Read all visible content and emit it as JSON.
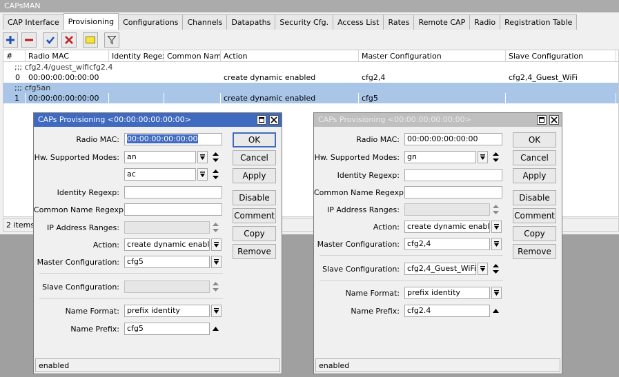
{
  "window": {
    "title": "CAPsMAN"
  },
  "tabs": [
    "CAP Interface",
    "Provisioning",
    "Configurations",
    "Channels",
    "Datapaths",
    "Security Cfg.",
    "Access List",
    "Rates",
    "Remote CAP",
    "Radio",
    "Registration Table"
  ],
  "active_tab": "Provisioning",
  "table": {
    "columns": [
      "#",
      "Radio MAC",
      "Identity Regexp",
      "Common Nam...",
      "Action",
      "Master Configuration",
      "Slave Configuration"
    ],
    "rows": [
      {
        "comment": ";;; cfg2.4/guest_wificfg2.4",
        "num": "0",
        "radio_mac": "00:00:00:00:00:00",
        "identity": "",
        "common": "",
        "action": "create dynamic enabled",
        "master": "cfg2,4",
        "slave": "cfg2,4_Guest_WiFi"
      },
      {
        "comment": ";;; cfg5an",
        "num": "1",
        "radio_mac": "00:00:00:00:00:00",
        "identity": "",
        "common": "",
        "action": "create dynamic enabled",
        "master": "cfg5",
        "slave": ""
      }
    ],
    "status": "2 items ("
  },
  "dialog1": {
    "title": "CAPs Provisioning <00:00:00:00:00:00>",
    "labels": {
      "radio_mac": "Radio MAC:",
      "hw_modes": "Hw. Supported Modes:",
      "identity": "Identity Regexp:",
      "common_name": "Common Name Regexp:",
      "ip_ranges": "IP Address Ranges:",
      "action": "Action:",
      "master": "Master Configuration:",
      "slave": "Slave Configuration:",
      "name_format": "Name Format:",
      "name_prefix": "Name Prefix:"
    },
    "values": {
      "radio_mac": "00:00:00:00:00:00",
      "hw_mode_1": "an",
      "hw_mode_2": "ac",
      "identity": "",
      "common_name": "",
      "ip_ranges": "",
      "action": "create dynamic enabled",
      "master": "cfg5",
      "slave": "",
      "name_format": "prefix identity",
      "name_prefix": "cfg5"
    },
    "buttons": {
      "ok": "OK",
      "cancel": "Cancel",
      "apply": "Apply",
      "disable": "Disable",
      "comment": "Comment",
      "copy": "Copy",
      "remove": "Remove"
    },
    "status": "enabled"
  },
  "dialog2": {
    "title": "CAPs Provisioning <00:00:00:00:00:00>",
    "labels": {
      "radio_mac": "Radio MAC:",
      "hw_modes": "Hw. Supported Modes:",
      "identity": "Identity Regexp:",
      "common_name": "Common Name Regexp:",
      "ip_ranges": "IP Address Ranges:",
      "action": "Action:",
      "master": "Master Configuration:",
      "slave": "Slave Configuration:",
      "name_format": "Name Format:",
      "name_prefix": "Name Prefix:"
    },
    "values": {
      "radio_mac": "00:00:00:00:00:00",
      "hw_mode_1": "gn",
      "identity": "",
      "common_name": "",
      "ip_ranges": "",
      "action": "create dynamic enabled",
      "master": "cfg2,4",
      "slave": "cfg2,4_Guest_WiFi",
      "name_format": "prefix identity",
      "name_prefix": "cfg2.4"
    },
    "buttons": {
      "ok": "OK",
      "cancel": "Cancel",
      "apply": "Apply",
      "disable": "Disable",
      "comment": "Comment",
      "copy": "Copy",
      "remove": "Remove"
    },
    "status": "enabled"
  }
}
